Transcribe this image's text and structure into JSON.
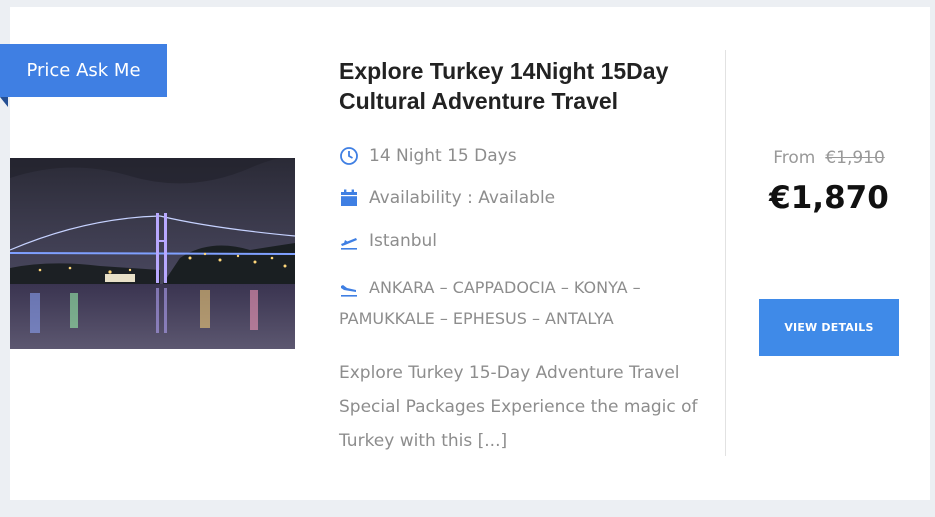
{
  "ribbon": {
    "label": "Price Ask Me",
    "color": "#3f7fe3"
  },
  "tour": {
    "title": "Explore Turkey 14Night 15Day Cultural Adventure Travel",
    "duration": "14 Night 15 Days",
    "availability": "Availability : Available",
    "departure": "Istanbul",
    "route": "ANKARA – CAPPADOCIA – KONYA – PAMUKKALE – EPHESUS – ANTALYA",
    "excerpt": "Explore Turkey 15-Day Adventure Travel Special Packages Experience the magic of Turkey with this [...]"
  },
  "icons": {
    "duration": "clock-icon",
    "availability": "calendar-icon",
    "departure": "plane-takeoff-icon",
    "route": "plane-landing-icon"
  },
  "pricing": {
    "from_label": "From",
    "old_price": "€1,910",
    "price": "€1,870"
  },
  "button": {
    "label": "VIEW DETAILS",
    "color": "#3f8ae8"
  },
  "accent_color": "#3f7fe3"
}
